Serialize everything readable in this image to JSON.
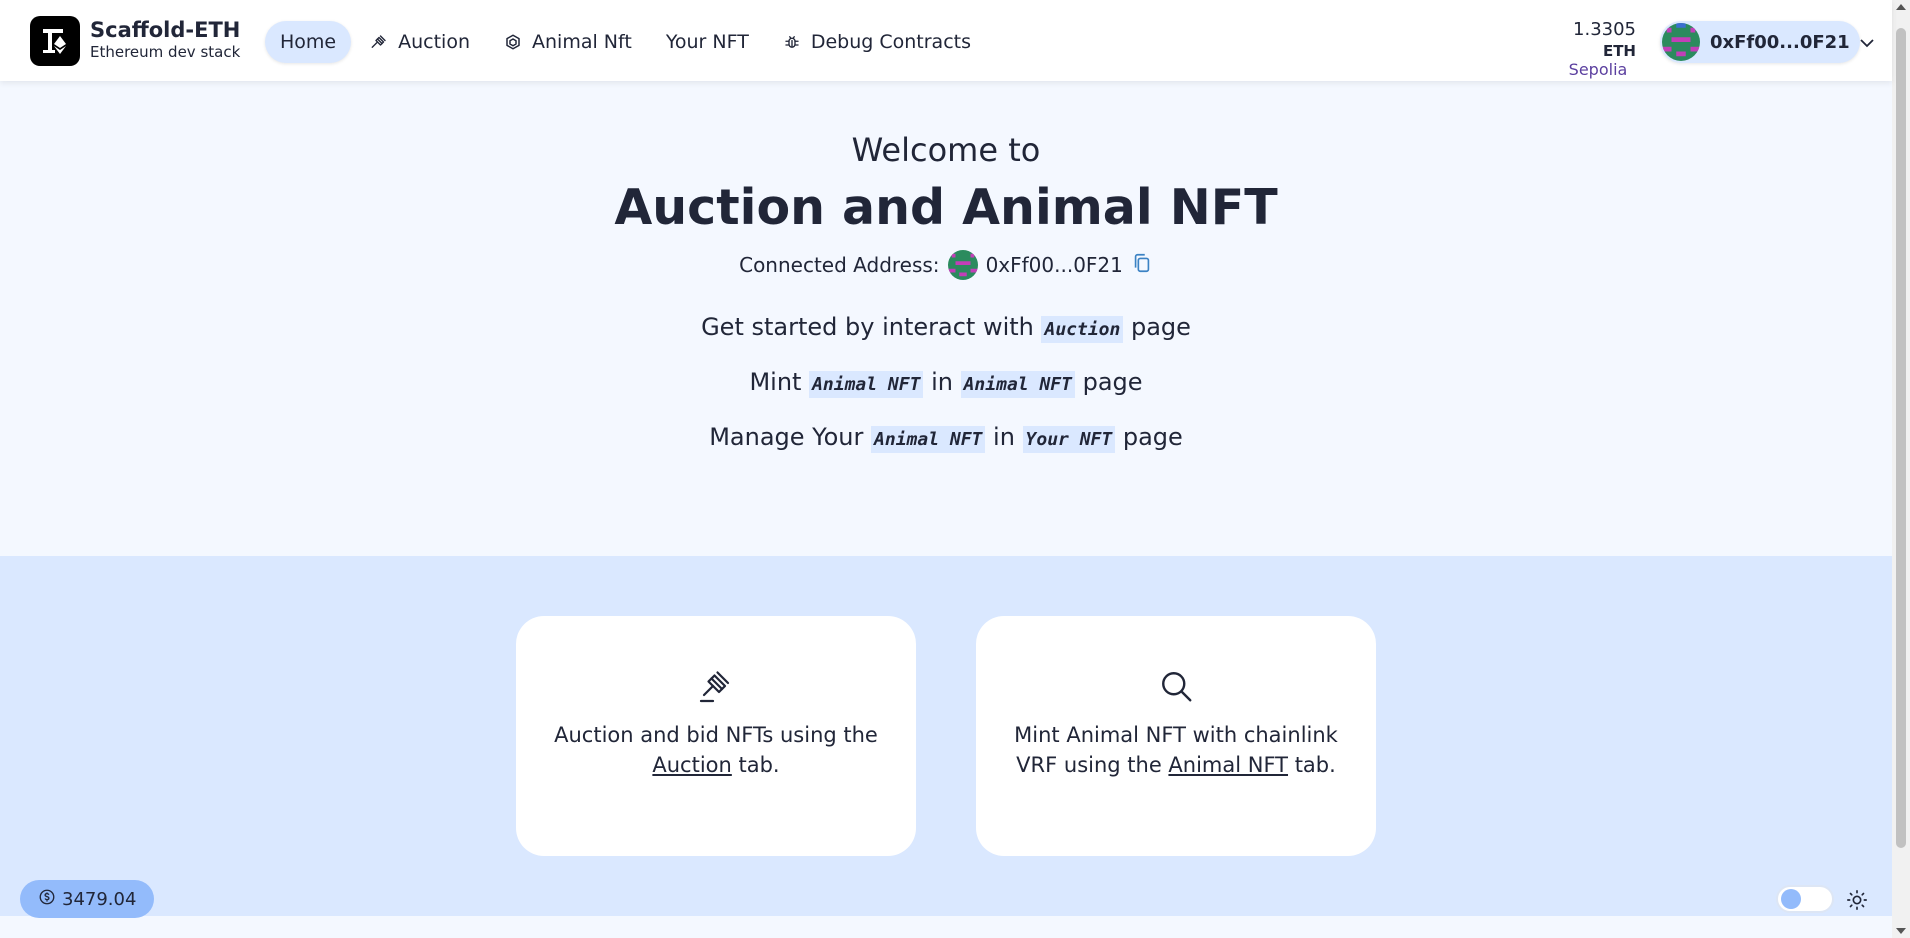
{
  "header": {
    "brand_name": "Scaffold-ETH",
    "brand_sub": "Ethereum dev stack",
    "nav": [
      {
        "label": "Home",
        "icon": "none",
        "active": true
      },
      {
        "label": "Auction",
        "icon": "gavel-icon"
      },
      {
        "label": "Animal Nft",
        "icon": "cube-icon"
      },
      {
        "label": "Your NFT",
        "icon": "none"
      },
      {
        "label": "Debug Contracts",
        "icon": "bug-icon"
      }
    ],
    "balance": {
      "amount": "1.3305",
      "unit": "ETH",
      "network": "Sepolia"
    },
    "account": {
      "address": "0xFf00...0F21"
    }
  },
  "hero": {
    "welcome": "Welcome to",
    "title": "Auction and Animal NFT",
    "connected_label": "Connected Address:",
    "connected_address": "0xFf00...0F21",
    "line1": {
      "pre": "Get started by interact with ",
      "code": "Auction",
      "post": " page"
    },
    "line2": {
      "pre": "Mint ",
      "code1": "Animal NFT",
      "mid": " in ",
      "code2": "Animal NFT",
      "post": " page"
    },
    "line3": {
      "pre": "Manage Your ",
      "code1": "Animal NFT",
      "mid": " in ",
      "code2": "Your NFT",
      "post": " page"
    }
  },
  "cards": [
    {
      "icon": "gavel-icon",
      "pre": "Auction and bid NFTs using the ",
      "link": "Auction",
      "post": " tab."
    },
    {
      "icon": "search-icon",
      "pre": "Mint Animal NFT with chainlink VRF using the ",
      "link": "Animal NFT",
      "post": " tab."
    }
  ],
  "footer": {
    "price": "3479.04"
  },
  "colors": {
    "accent": "#dae8ff",
    "primary": "#93bbfb",
    "network": "#5b3f9f",
    "text": "#212638"
  }
}
